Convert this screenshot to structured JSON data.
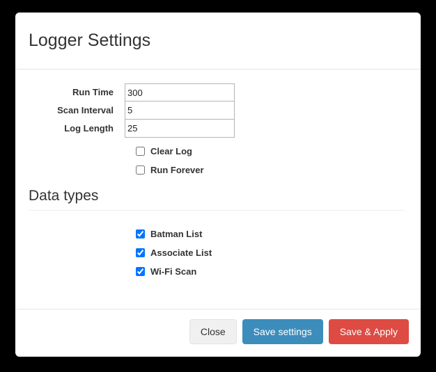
{
  "modal": {
    "title": "Logger Settings",
    "form": {
      "fields": [
        {
          "label": "Run Time",
          "value": "300"
        },
        {
          "label": "Scan Interval",
          "value": "5"
        },
        {
          "label": "Log Length",
          "value": "25"
        }
      ],
      "options": [
        {
          "label": "Clear Log",
          "checked": false
        },
        {
          "label": "Run Forever",
          "checked": false
        }
      ]
    },
    "data_types": {
      "heading": "Data types",
      "items": [
        {
          "label": "Batman List",
          "checked": true
        },
        {
          "label": "Associate List",
          "checked": true
        },
        {
          "label": "Wi-Fi Scan",
          "checked": true
        }
      ]
    },
    "footer": {
      "close_label": "Close",
      "save_label": "Save settings",
      "save_apply_label": "Save & Apply"
    }
  },
  "colors": {
    "backdrop": "#000000",
    "surface": "#ffffff",
    "text": "#333333",
    "primary": "#3c8dbc",
    "danger": "#dd4b43",
    "default_button": "#f0f0f0",
    "divider": "#e5e5e5",
    "input_border": "#b3b3b3"
  }
}
